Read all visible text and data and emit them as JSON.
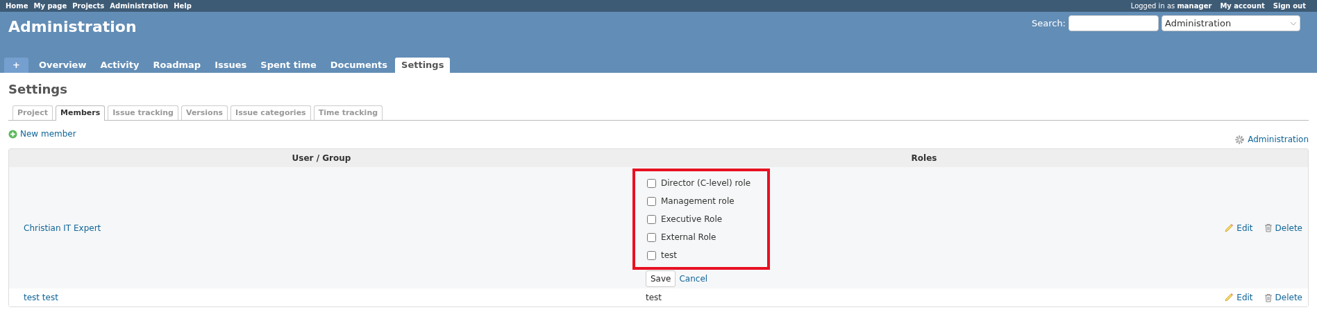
{
  "top_menu": [
    "Home",
    "My page",
    "Projects",
    "Administration",
    "Help"
  ],
  "account": {
    "logged_in_label": "Logged in as",
    "user": "manager",
    "links": [
      "My account",
      "Sign out"
    ]
  },
  "header": {
    "title": "Administration",
    "search_label": "Search:",
    "project_select": "Administration"
  },
  "new_button": "+",
  "main_tabs": [
    {
      "label": "Overview",
      "kind": "tab",
      "selected": false
    },
    {
      "label": "Activity",
      "kind": "tab",
      "selected": false
    },
    {
      "label": "Roadmap",
      "kind": "tab",
      "selected": false
    },
    {
      "label": "Issues",
      "kind": "tab",
      "selected": false
    },
    {
      "label": "Spent time",
      "kind": "tab",
      "selected": false
    },
    {
      "label": "Documents",
      "kind": "tab",
      "selected": false
    },
    {
      "label": "Settings",
      "kind": "tab",
      "selected": true
    }
  ],
  "page_title": "Settings",
  "settings_tabs": [
    {
      "label": "Project",
      "selected": false
    },
    {
      "label": "Members",
      "selected": true
    },
    {
      "label": "Issue tracking",
      "selected": false
    },
    {
      "label": "Versions",
      "selected": false
    },
    {
      "label": "Issue categories",
      "selected": false
    },
    {
      "label": "Time tracking",
      "selected": false
    }
  ],
  "new_member": "New member",
  "admin_link": "Administration",
  "table": {
    "columns": [
      "User / Group",
      "Roles"
    ],
    "rows": [
      {
        "name": "Christian IT Expert",
        "kind": "edit",
        "highlighted": true,
        "roles": [
          {
            "label": "Director (C-level) role",
            "checked": false
          },
          {
            "label": "Management role",
            "checked": false
          },
          {
            "label": "Executive Role",
            "checked": false
          },
          {
            "label": "External Role",
            "checked": false
          },
          {
            "label": "test",
            "checked": false
          }
        ],
        "save": "Save",
        "cancel": "Cancel",
        "actions": [
          "Edit",
          "Delete"
        ]
      },
      {
        "name": "test test",
        "kind": "view",
        "roles_text": "test",
        "actions": [
          "Edit",
          "Delete"
        ]
      }
    ]
  }
}
